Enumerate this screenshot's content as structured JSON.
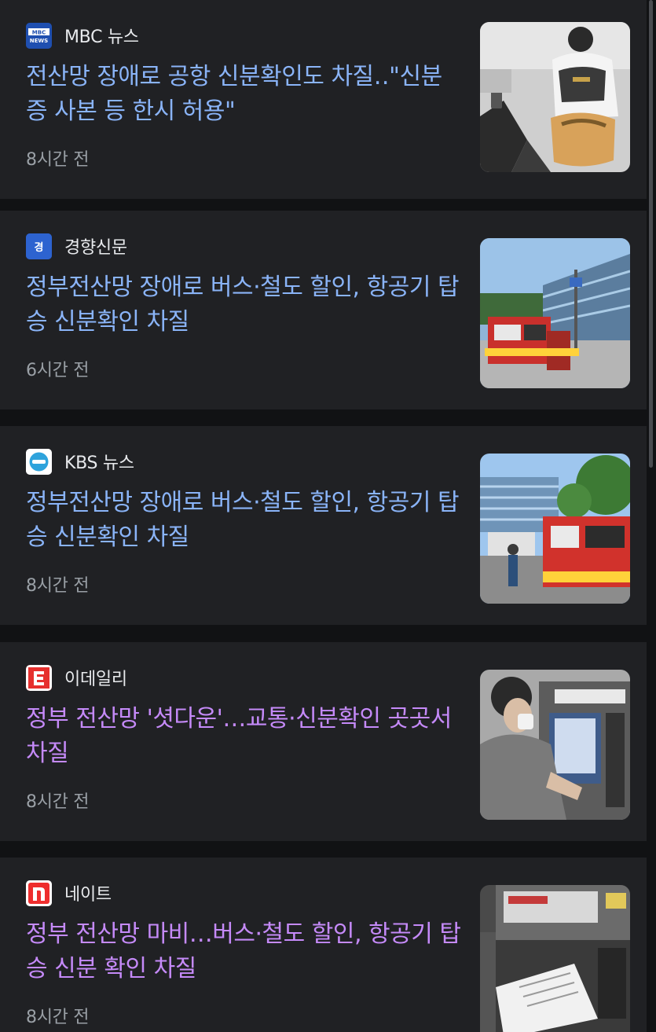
{
  "articles": [
    {
      "source": "MBC 뉴스",
      "logo_icon": "mbc-news-logo",
      "headline": "전산망 장애로 공항 신분확인도 차질‥\"신분증 사본 등 한시 허용\"",
      "time": "8시간 전",
      "visited": false,
      "thumbnail_icon": "airport-crowd-photo"
    },
    {
      "source": "경향신문",
      "logo_icon": "kyunghyang-logo",
      "headline": "정부전산망 장애로 버스·철도 할인, 항공기 탑승 신분확인 차질",
      "time": "6시간 전",
      "visited": false,
      "thumbnail_icon": "fire-truck-building-photo"
    },
    {
      "source": "KBS 뉴스",
      "logo_icon": "kbs-news-logo",
      "headline": "정부전산망 장애로 버스·철도 할인, 항공기 탑승 신분확인 차질",
      "time": "8시간 전",
      "visited": false,
      "thumbnail_icon": "fire-truck-building-photo"
    },
    {
      "source": "이데일리",
      "logo_icon": "edaily-logo",
      "headline": "정부 전산망 '셧다운'…교통·신분확인 곳곳서 차질",
      "time": "8시간 전",
      "visited": true,
      "thumbnail_icon": "kiosk-user-photo"
    },
    {
      "source": "네이트",
      "logo_icon": "nate-logo",
      "headline": "정부 전산망 마비…버스·철도 할인, 항공기 탑승 신분 확인 차질",
      "time": "8시간 전",
      "visited": true,
      "thumbnail_icon": "kiosk-document-photo"
    }
  ],
  "colors": {
    "unvisited_link": "#8ab4f8",
    "visited_link": "#c58af9",
    "card_background": "#202124",
    "page_background": "#111214"
  }
}
